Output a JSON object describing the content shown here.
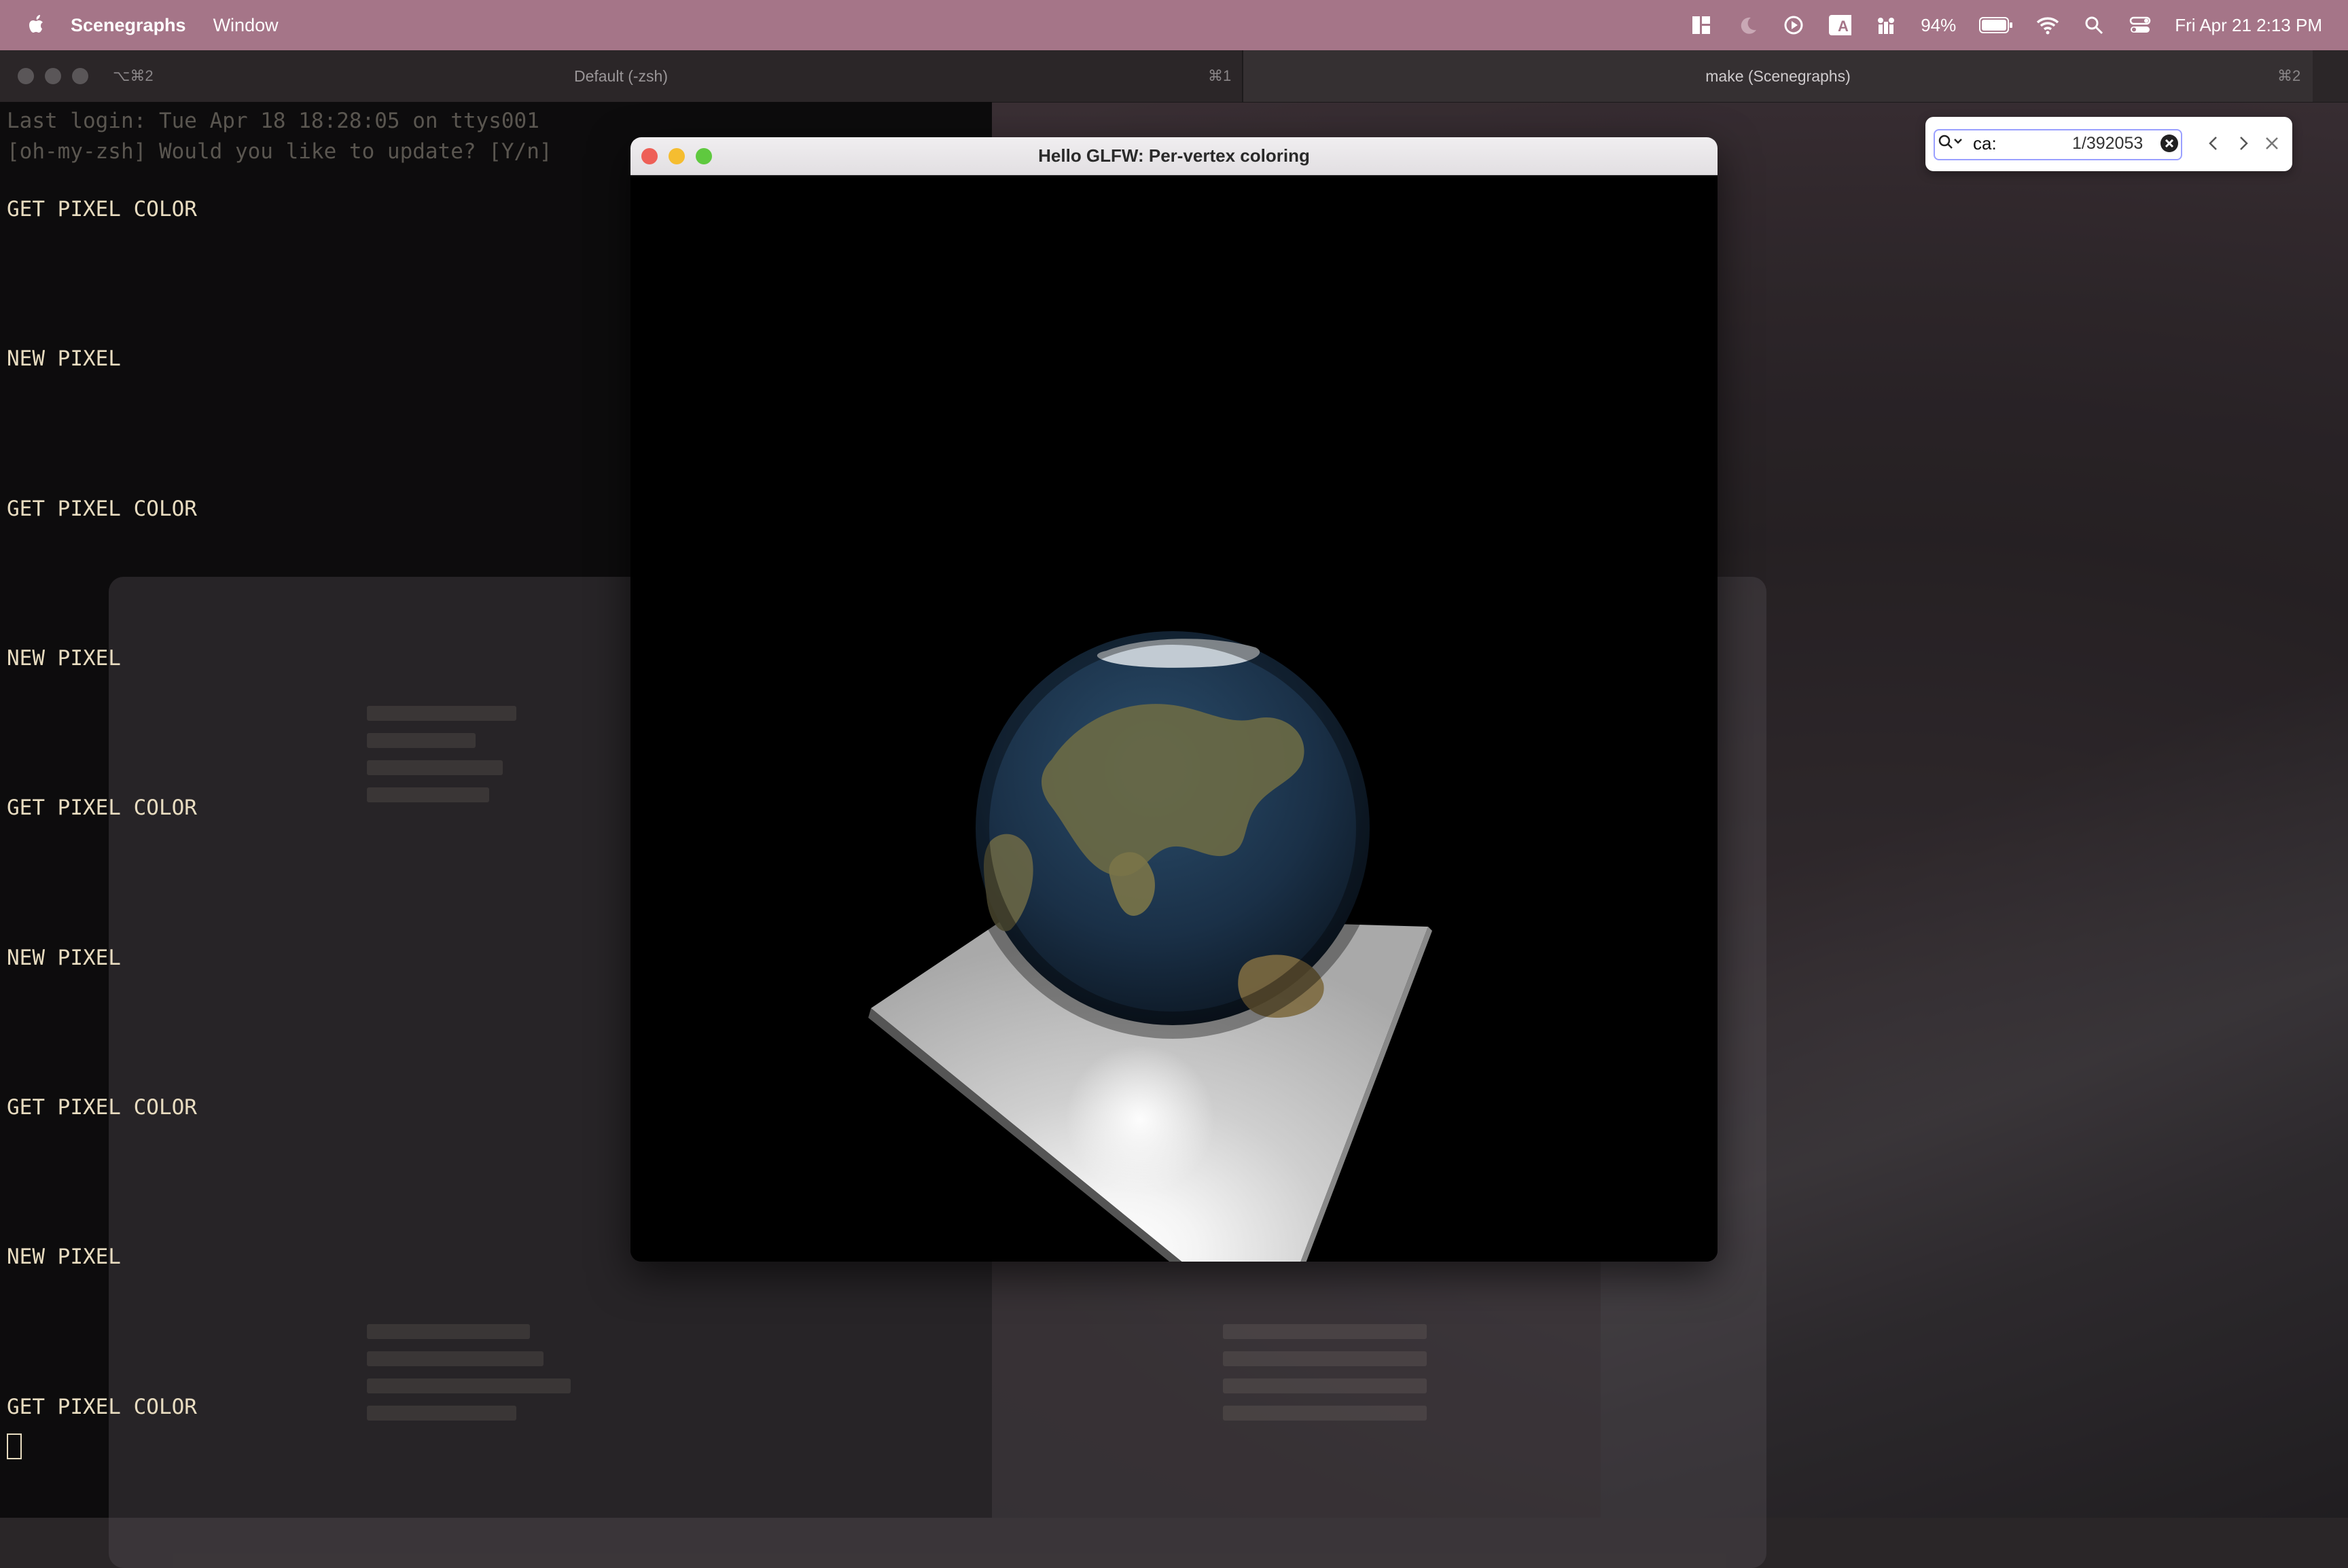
{
  "menubar": {
    "app_name": "Scenegraphs",
    "menu_window": "Window",
    "battery_percent": "94%",
    "datetime": "Fri Apr 21  2:13 PM"
  },
  "terminal": {
    "tab1_shortcut_left": "⌥⌘2",
    "tab1_title": "Default (-zsh)",
    "tab1_shortcut_right": "⌘1",
    "tab2_title": "make (Scenegraphs)",
    "tab2_shortcut": "⌘2",
    "faded_line_1": "Last login: Tue Apr 18 18:28:05 on ttys001",
    "faded_line_2": "[oh-my-zsh] Would you like to update? [Y/n]",
    "lines": [
      "GET PIXEL COLOR",
      "NEW PIXEL",
      "GET PIXEL COLOR",
      "NEW PIXEL",
      "GET PIXEL COLOR",
      "NEW PIXEL",
      "GET PIXEL COLOR",
      "NEW PIXEL",
      "GET PIXEL COLOR"
    ]
  },
  "search": {
    "query": "ca:",
    "count": "1/392053"
  },
  "glfw": {
    "title": "Hello GLFW: Per-vertex coloring"
  },
  "colors": {
    "menubar": "#a57588",
    "terminal_text": "#e8dcc0",
    "ocean": "#1e3a55",
    "land": "#6b6a45",
    "plane": "#d9d9d9"
  }
}
